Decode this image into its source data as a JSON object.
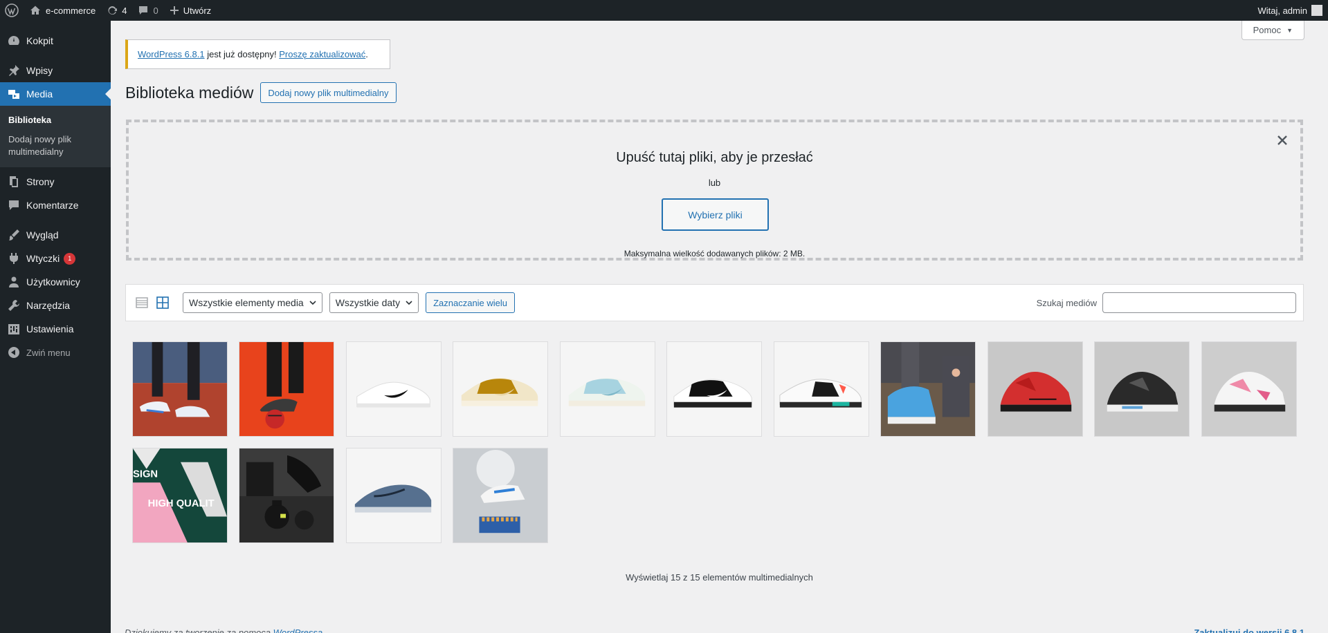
{
  "admin_bar": {
    "site_name": "e-commerce",
    "updates_count": "4",
    "comments_count": "0",
    "new_label": "Utwórz",
    "greeting": "Witaj, admin"
  },
  "sidebar": {
    "items": [
      {
        "label": "Kokpit",
        "icon": "dashboard-icon"
      },
      {
        "label": "Wpisy",
        "icon": "pin-icon"
      },
      {
        "label": "Media",
        "icon": "media-icon"
      },
      {
        "label": "Strony",
        "icon": "pages-icon"
      },
      {
        "label": "Komentarze",
        "icon": "comments-icon"
      },
      {
        "label": "Wygląd",
        "icon": "appearance-icon"
      },
      {
        "label": "Wtyczki",
        "icon": "plugins-icon",
        "badge": "1"
      },
      {
        "label": "Użytkownicy",
        "icon": "users-icon"
      },
      {
        "label": "Narzędzia",
        "icon": "tools-icon"
      },
      {
        "label": "Ustawienia",
        "icon": "settings-icon"
      }
    ],
    "submenu": [
      "Biblioteka",
      "Dodaj nowy plik multimedialny"
    ],
    "collapse_label": "Zwiń menu"
  },
  "help_tab": "Pomoc",
  "notice": {
    "link1": "WordPress 6.8.1",
    "text": " jest już dostępny! ",
    "link2": "Proszę zaktualizować",
    "end": "."
  },
  "page": {
    "title": "Biblioteka mediów",
    "add_new": "Dodaj nowy plik multimedialny"
  },
  "uploader": {
    "title": "Upuść tutaj pliki, aby je przesłać",
    "or": "lub",
    "select_button": "Wybierz pliki",
    "max_size": "Maksymalna wielkość dodawanych plików: 2 MB."
  },
  "toolbar": {
    "filter_type": "Wszystkie elementy media",
    "filter_date": "Wszystkie daty",
    "bulk_select": "Zaznaczanie wielu",
    "search_label": "Szukaj mediów",
    "search_value": ""
  },
  "media_items": [
    {
      "name": "running-shoes-track"
    },
    {
      "name": "football-boot-ball"
    },
    {
      "name": "white-sneaker"
    },
    {
      "name": "gold-dunk-sneaker"
    },
    {
      "name": "light-blue-dunk-sneaker"
    },
    {
      "name": "black-white-dunk-sneaker"
    },
    {
      "name": "white-air-max-sneaker"
    },
    {
      "name": "blue-jordan-on-foot"
    },
    {
      "name": "red-jordan-sneaker"
    },
    {
      "name": "black-jordan-sneaker"
    },
    {
      "name": "pink-white-jordan-sneaker"
    },
    {
      "name": "design-high-quality-banner",
      "text_line1": "SIGN",
      "text_line2": "HIGH QUALIT"
    },
    {
      "name": "kettlebell-workout"
    },
    {
      "name": "grey-running-shoe"
    },
    {
      "name": "shoe-basketball-display"
    }
  ],
  "display_count": "Wyświetlaj 15 z 15 elementów multimedialnych",
  "footer": {
    "thanks_prefix": "Dziękujemy za tworzenie za pomocą ",
    "thanks_link": "WordPressa",
    "update_link": "Zaktualizuj do wersji 6.8.1"
  }
}
